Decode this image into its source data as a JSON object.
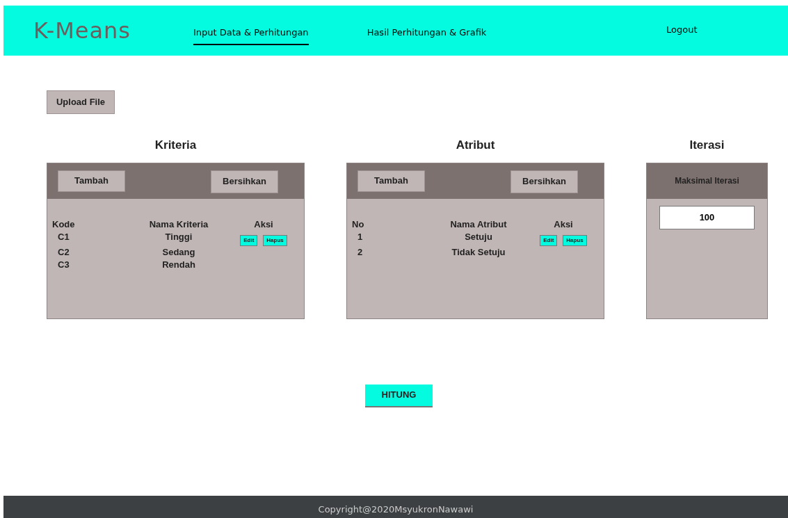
{
  "brand": "K-Means",
  "nav": [
    {
      "label": "Input Data & Perhitungan",
      "selected": true
    },
    {
      "label": "Hasil Perhitungan & Grafik",
      "selected": false
    }
  ],
  "logout": "Logout",
  "upload_button": "Upload File",
  "panels": [
    {
      "title": "Kriteria",
      "add_button": "Tambah",
      "clear_button": "Bersihkan",
      "columns": [
        "Kode",
        "Nama Kriteria",
        "Aksi"
      ],
      "rows": [
        [
          "C1",
          "Tinggi"
        ],
        [
          "C2",
          "Sedang"
        ],
        [
          "C3",
          "Rendah"
        ]
      ],
      "actions": [
        "Edit",
        "Hapus"
      ]
    },
    {
      "title": "Atribut",
      "add_button": "Tambah",
      "clear_button": "Bersihkan",
      "columns": [
        "No",
        "Nama Atribut",
        "Aksi"
      ],
      "rows": [
        [
          "1",
          "Setuju"
        ],
        [
          "2",
          "Tidak Setuju"
        ]
      ],
      "actions": [
        "Edit",
        "Hapus"
      ]
    }
  ],
  "iteration": {
    "title": "Iterasi",
    "label": "Maksimal Iterasi",
    "value": "100"
  },
  "compute_button": "HITUNG",
  "footer": "Copyright@2020MsyukronNawawi"
}
